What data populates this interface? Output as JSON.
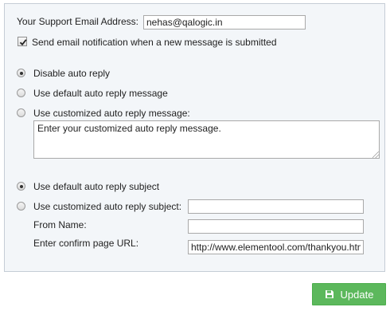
{
  "support_email": {
    "label": "Your Support Email Address:",
    "value": "nehas@qalogic.in"
  },
  "notify": {
    "label": "Send email notification when a new message is submitted",
    "checked": true
  },
  "auto_reply": {
    "disable_label": "Disable auto reply",
    "default_label": "Use default auto reply message",
    "custom_label": "Use customized auto reply message:",
    "selected": "disable",
    "custom_message_value": "Enter your customized auto reply message."
  },
  "subject": {
    "default_label": "Use default auto reply subject",
    "custom_label": "Use customized auto reply subject:",
    "selected": "default",
    "custom_value": ""
  },
  "from_name": {
    "label": "From Name:",
    "value": ""
  },
  "confirm_url": {
    "label": "Enter confirm page URL:",
    "value": "http://www.elementool.com/thankyou.htm"
  },
  "update_button": {
    "label": "Update",
    "color": "#5cb85c",
    "icon": "floppy-disk-icon"
  }
}
